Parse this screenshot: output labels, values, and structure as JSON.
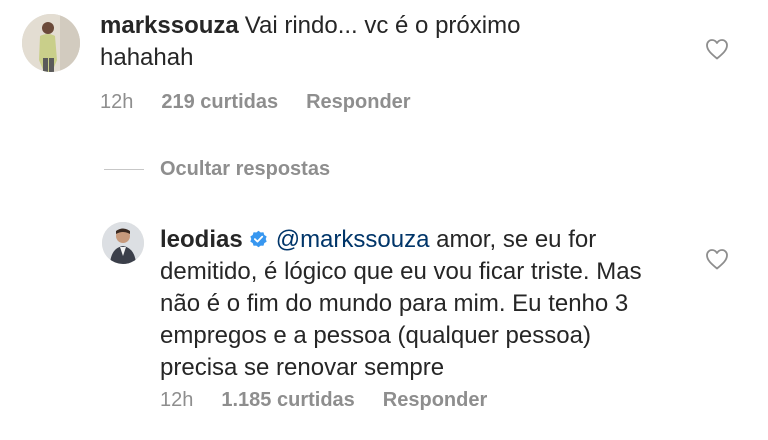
{
  "comments": [
    {
      "username": "markssouza",
      "text": "Vai rindo... vc é o próximo hahahah",
      "time": "12h",
      "likes": "219 curtidas",
      "reply": "Responder"
    },
    {
      "username": "leodias",
      "mention": "@markssouza",
      "text": " amor, se eu for demitido, é lógico que eu vou ficar triste. Mas não é o fim do mundo para mim. Eu tenho 3 empregos e a pessoa (qualquer pessoa) precisa se renovar sempre",
      "time": "12h",
      "likes": "1.185 curtidas",
      "reply": "Responder"
    }
  ],
  "replies_toggle": "Ocultar respostas",
  "colors": {
    "text": "#262626",
    "meta": "#8e8e8e",
    "mention": "#003569",
    "verified": "#3897f0"
  },
  "icons": {
    "like": "heart-outline-icon",
    "verified": "verified-badge-icon"
  }
}
